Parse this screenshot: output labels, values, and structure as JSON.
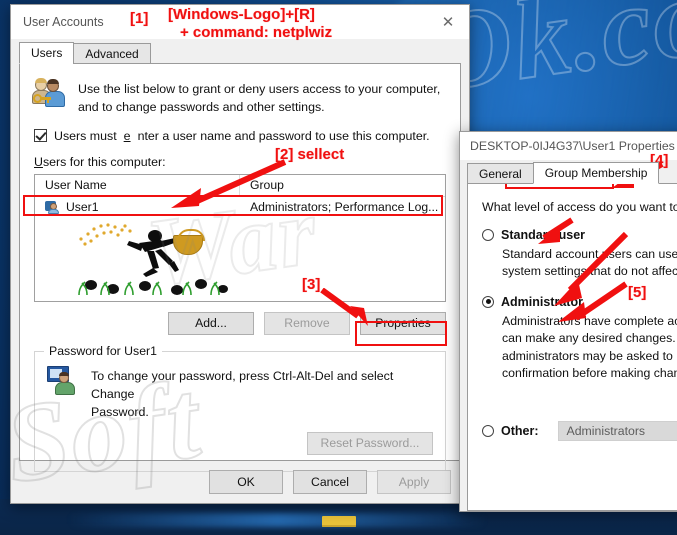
{
  "desktop": {
    "taskbar_icon": "folder-icon"
  },
  "watermark": {
    "left": "Soft",
    "right": "Ok.com",
    "middle": "War"
  },
  "user_accounts": {
    "title": "User Accounts",
    "close_label": "✕",
    "tabs": [
      {
        "label": "Users",
        "active": true
      },
      {
        "label": "Advanced",
        "active": false
      }
    ],
    "intro_line1": "Use the list below to grant or deny users access to your computer,",
    "intro_line2": "and to change passwords and other settings.",
    "require_password_checkbox": {
      "checked": true,
      "label_pre": "Users must ",
      "label_accel": "e",
      "label_post": "nter a user name and password to use this computer."
    },
    "list_label_pre": "U",
    "list_label_accel": "",
    "list_label_post": "sers for this computer:",
    "list_label": "Users for this computer:",
    "columns": [
      "User Name",
      "Group"
    ],
    "rows": [
      {
        "user_name": "User1",
        "group": "Administrators; Performance Log..."
      }
    ],
    "buttons": {
      "add": "Add...",
      "remove": "Remove",
      "properties": "Properties"
    },
    "password_group": {
      "legend": "Password for User1",
      "text_line1": "To change your password, press Ctrl-Alt-Del and select Change",
      "text_line2": "Password.",
      "reset_button": "Reset Password..."
    },
    "footer": {
      "ok": "OK",
      "cancel": "Cancel",
      "apply": "Apply"
    }
  },
  "properties": {
    "title": "DESKTOP-0IJ4G37\\User1 Properties",
    "tabs": [
      {
        "label": "General",
        "active": false
      },
      {
        "label": "Group Membership",
        "active": true
      }
    ],
    "question": "What level of access do you want to g",
    "options": [
      {
        "label": "Standard user",
        "selected": false,
        "desc_line1": "Standard account users can use m",
        "desc_line2": "system settings that do not affect"
      },
      {
        "label": "Administrator",
        "selected": true,
        "desc_line1": "Administrators have complete ac",
        "desc_line2": "can make any desired changes. B",
        "desc_line3": "administrators may be asked to p",
        "desc_line4": "confirmation before making chan"
      }
    ],
    "other": {
      "label": "Other:",
      "value": "Administrators",
      "selected": false
    }
  },
  "annotations": {
    "a1_tag": "[1]",
    "a1_line1": "[Windows-Logo]+[R]",
    "a1_line2": "+ command: netplwiz",
    "a2": "[2] sellect",
    "a3": "[3]",
    "a4": "[4]",
    "a5": "[5]"
  },
  "colors": {
    "annotation_red": "#f01010",
    "desktop_blue": "#0b3a72",
    "window_face": "#f0f0f0"
  }
}
